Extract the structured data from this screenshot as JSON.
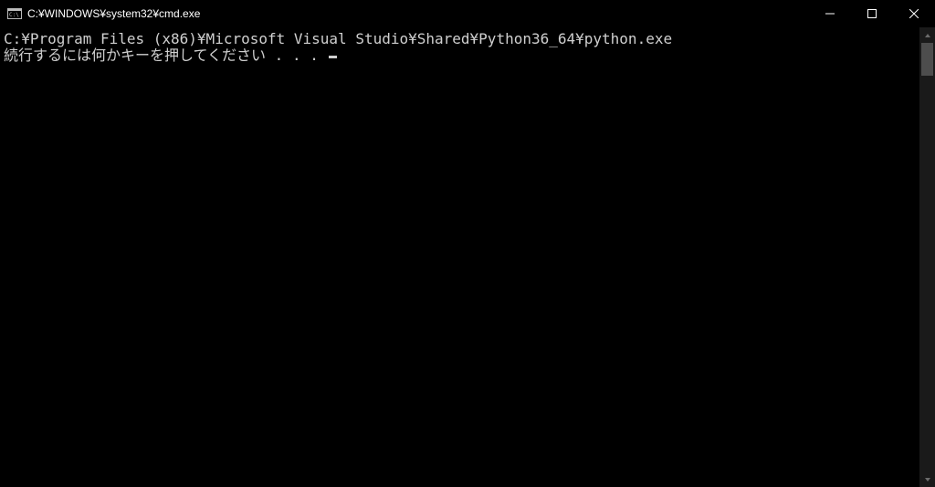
{
  "window": {
    "title": "C:¥WINDOWS¥system32¥cmd.exe"
  },
  "terminal": {
    "line1": "C:¥Program Files (x86)¥Microsoft Visual Studio¥Shared¥Python36_64¥python.exe",
    "line2": "続行するには何かキーを押してください . . . "
  }
}
